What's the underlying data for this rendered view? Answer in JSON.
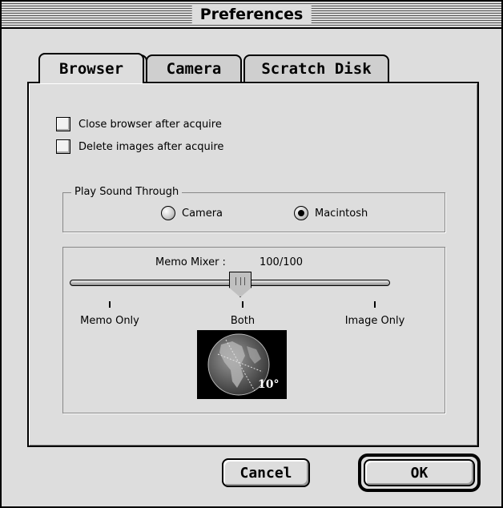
{
  "window": {
    "title": "Preferences"
  },
  "tabs": [
    {
      "label": "Browser",
      "active": true
    },
    {
      "label": "Camera",
      "active": false
    },
    {
      "label": "Scratch Disk",
      "active": false
    }
  ],
  "options": {
    "close_browser": {
      "label": "Close browser after acquire",
      "checked": false
    },
    "delete_images": {
      "label": "Delete images after acquire",
      "checked": false
    }
  },
  "sound": {
    "group_label": "Play Sound Through",
    "options": [
      {
        "label": "Camera",
        "selected": false
      },
      {
        "label": "Macintosh",
        "selected": true
      }
    ]
  },
  "mixer": {
    "label": "Memo Mixer :",
    "value_text": "100/100",
    "position": 0.5,
    "ticks": [
      "Memo Only",
      "Both",
      "Image Only"
    ],
    "preview_caption": "10°"
  },
  "buttons": {
    "cancel": "Cancel",
    "ok": "OK"
  },
  "colors": {
    "background": "#dddddd",
    "frame": "#000000",
    "preview_bg": "#000000"
  }
}
